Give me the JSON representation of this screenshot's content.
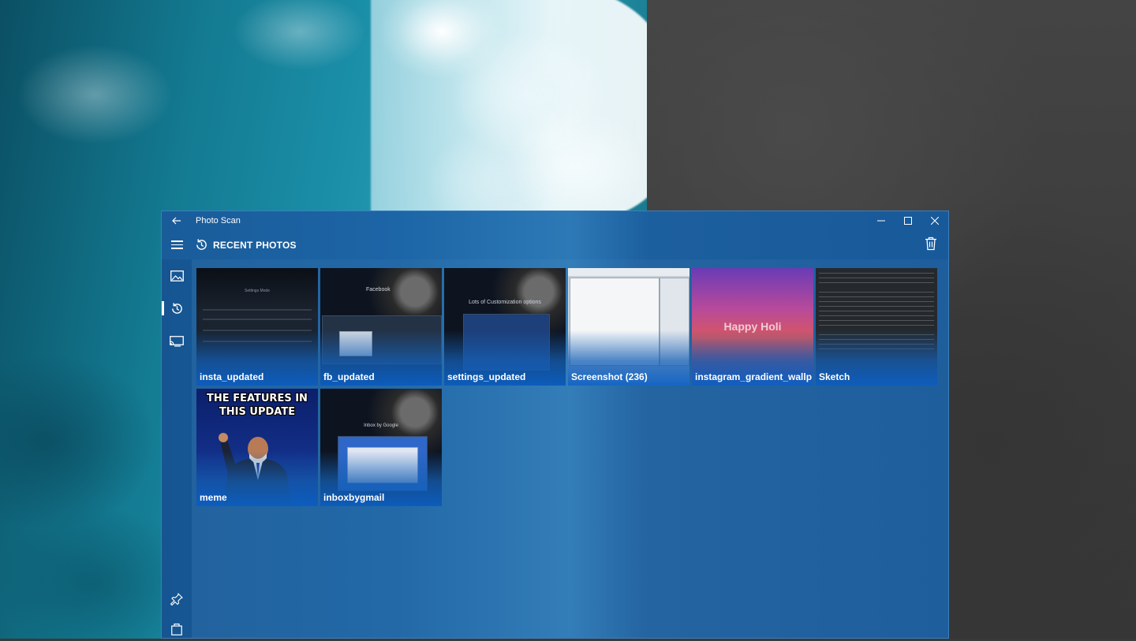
{
  "window": {
    "title": "Photo Scan"
  },
  "header": {
    "page_title": "RECENT PHOTOS"
  },
  "nav": {
    "items": [
      {
        "icon": "image-icon"
      },
      {
        "icon": "history-icon",
        "active": true
      },
      {
        "icon": "cast-icon"
      }
    ],
    "bottom": [
      {
        "icon": "pin-icon"
      },
      {
        "icon": "store-icon"
      }
    ]
  },
  "photos": [
    {
      "label": "insta_updated"
    },
    {
      "label": "fb_updated"
    },
    {
      "label": "settings_updated"
    },
    {
      "label": "Screenshot (236)"
    },
    {
      "label": "instagram_gradient_wallpaper"
    },
    {
      "label": "Sketch"
    },
    {
      "label": "meme"
    },
    {
      "label": "inboxbygmail"
    }
  ],
  "thumbnail_text": {
    "settings_mode": "Settings Mode",
    "facebook": "Facebook",
    "customization": "Lots of Customization options",
    "happy_holi": "Happy Holi",
    "meme_caption": "THE FEATURES IN THIS UPDATE",
    "inbox": "Inbox by Google"
  },
  "colors": {
    "window_bg": "#1c65a6",
    "accent": "#0c60c4",
    "text": "#ffffff"
  }
}
